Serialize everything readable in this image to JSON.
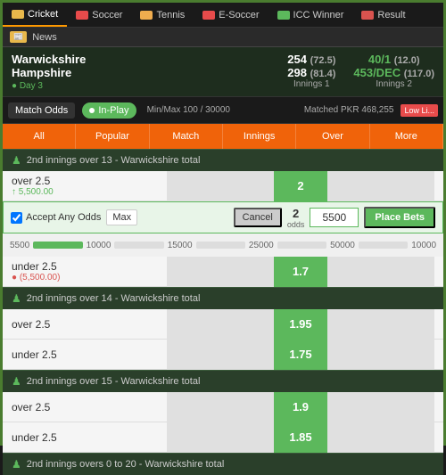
{
  "topNav": {
    "tabs": [
      {
        "id": "cricket",
        "label": "Cricket",
        "iconClass": "icon-cricket",
        "active": true
      },
      {
        "id": "soccer",
        "label": "Soccer",
        "iconClass": "icon-soccer",
        "active": false
      },
      {
        "id": "tennis",
        "label": "Tennis",
        "iconClass": "icon-tennis",
        "active": false
      },
      {
        "id": "esoccer",
        "label": "E-Soccer",
        "iconClass": "icon-esoccer",
        "active": false
      },
      {
        "id": "icc",
        "label": "ICC Winner",
        "iconClass": "icon-icc",
        "active": false
      },
      {
        "id": "result",
        "label": "Result",
        "iconClass": "icon-result",
        "active": false
      }
    ]
  },
  "newsBar": {
    "label": "📰 News"
  },
  "matchHeader": {
    "team1": "Warwickshire",
    "team2": "Hampshire",
    "dayLabel": "● Day 3",
    "score1": "254",
    "score1Over": "(72.5)",
    "score2": "298",
    "score2Over": "(81.4)",
    "innings1Label": "Innings 1",
    "score3": "40/1",
    "score3Over": "(12.0)",
    "score4": "453/DEC",
    "score4Over": "(117.0)",
    "innings2Label": "Innings 2"
  },
  "controls": {
    "matchOddsLabel": "Match Odds",
    "inPlayLabel": "In-Play",
    "minMax": "Min/Max 100 / 30000",
    "matched": "Matched PKR 468,255",
    "lowLiq": "Low Li..."
  },
  "filterTabs": {
    "tabs": [
      {
        "label": "All",
        "active": false
      },
      {
        "label": "Popular",
        "active": false
      },
      {
        "label": "Match",
        "active": false
      },
      {
        "label": "Innings",
        "active": false
      },
      {
        "label": "Over",
        "active": false
      },
      {
        "label": "More",
        "active": false
      }
    ]
  },
  "sections": [
    {
      "id": "section1",
      "title": "2nd innings over 13 - Warwickshire total",
      "rows": [
        {
          "label": "over 2.5",
          "subLabel": "↑ 5,500.00",
          "subLabelColor": "green",
          "backOdds": "2",
          "layOdds": null,
          "hasBetSlip": true
        },
        {
          "label": "under 2.5",
          "subLabel": "● (5,500.00)",
          "subLabelColor": "red",
          "backOdds": "1.7",
          "layOdds": null,
          "hasBetSlip": false,
          "profitLabel": "● (5,500.00)"
        }
      ]
    },
    {
      "id": "section2",
      "title": "2nd innings over 14 - Warwickshire total",
      "rows": [
        {
          "label": "over 2.5",
          "subLabel": "",
          "backOdds": "1.95",
          "layOdds": null
        },
        {
          "label": "under 2.5",
          "subLabel": "",
          "backOdds": "1.75",
          "layOdds": null
        }
      ]
    },
    {
      "id": "section3",
      "title": "2nd innings over 15 - Warwickshire total",
      "rows": [
        {
          "label": "over 2.5",
          "subLabel": "",
          "backOdds": "1.9",
          "layOdds": null
        },
        {
          "label": "under 2.5",
          "subLabel": "",
          "backOdds": "1.85",
          "layOdds": null
        }
      ]
    },
    {
      "id": "section4",
      "title": "2nd innings overs 0 to 20 - Warwickshire total",
      "rows": []
    }
  ],
  "betSlip": {
    "acceptLabel": "Accept Any Odds",
    "maxLabel": "Max",
    "cancelLabel": "Cancel",
    "oddsLabel": "odds",
    "oddsValue": "2",
    "stakeValue": "5500",
    "placeBetsLabel": "Place Bets"
  },
  "slider": {
    "values": [
      "5500",
      "10000",
      "15000",
      "25000",
      "50000",
      "10000"
    ]
  }
}
